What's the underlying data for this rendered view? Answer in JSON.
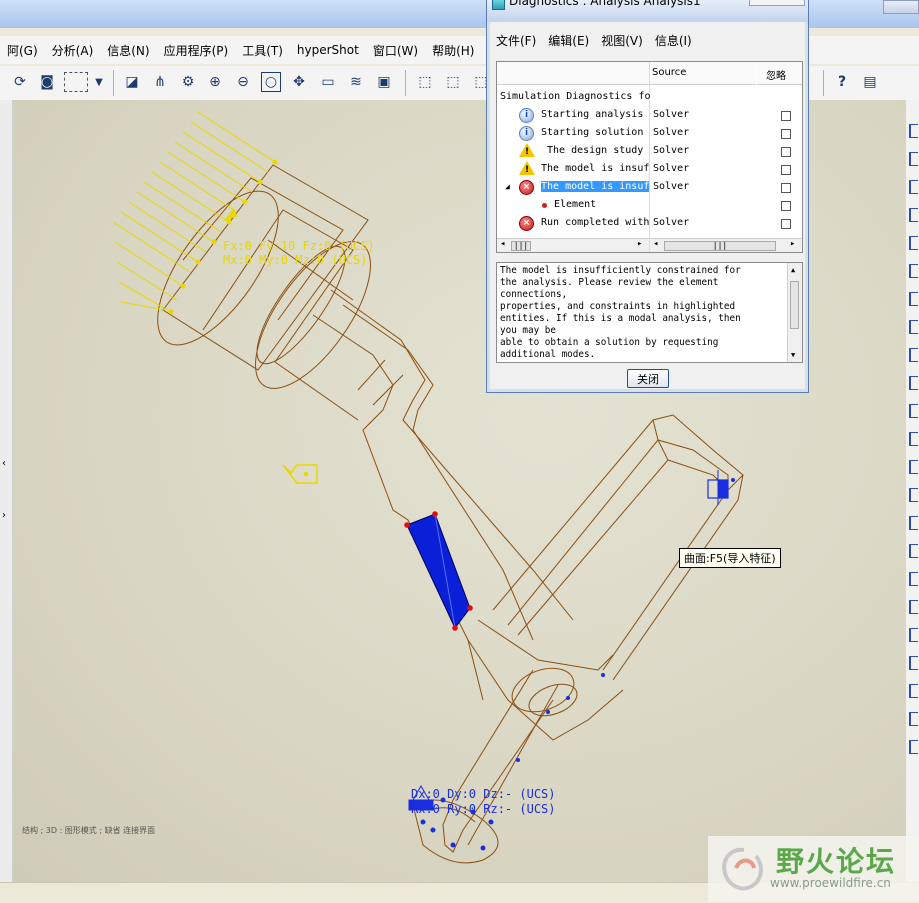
{
  "app": {
    "menus": [
      "阿(G)",
      "分析(A)",
      "信息(N)",
      "应用程序(P)",
      "工具(T)",
      "hyperShot",
      "窗口(W)",
      "帮助(H)"
    ]
  },
  "toolbar": {
    "icons": [
      "repaint-icon",
      "binoculars-icon",
      "select-box-icon",
      "dropdown-icon",
      "sketch-icon",
      "datum-point-icon",
      "orient-icon",
      "zoom-in-icon",
      "zoom-out-icon",
      "zoom-fit-icon",
      "spin-center-icon",
      "annotation-icon",
      "layers-icon",
      "saved-views-icon",
      "shaded-icon",
      "hidden-line-icon",
      "wireframe-icon",
      "whats-this-icon",
      "model-tree-icon"
    ]
  },
  "viewport": {
    "load_label_force": "Fx:0 Fy:10 Fz:0 (UCS)",
    "load_label_moment": "Mx:0 My:0 Mz:0 (UCS)",
    "constraint_label_disp": "Dx:0 Dy:0 Dz:- (UCS)",
    "constraint_label_rot": "Rx:0 Ry:0 Rz:- (UCS)",
    "tooltip": "曲面:F5(导入特征)",
    "status_hint": "结构 ; 3D : 图形模式 ; 缺省 连接界面"
  },
  "dialog": {
    "title": "Diagnostics : Analysis Analysis1",
    "menus": [
      "文件(F)",
      "编辑(E)",
      "视图(V)",
      "信息(I)"
    ],
    "tree": {
      "col_source": "Source",
      "col_ignore": "忽略",
      "root": "Simulation Diagnostics fo",
      "rows": [
        {
          "icon": "info",
          "text": "Starting analysis",
          "source": "Solver"
        },
        {
          "icon": "info",
          "text": "Starting solution",
          "source": "Solver"
        },
        {
          "icon": "warn",
          "text": "The design study",
          "source": "Solver"
        },
        {
          "icon": "warn",
          "text": "The model is insuf",
          "source": "Solver"
        },
        {
          "icon": "err",
          "text": "The model is insuf",
          "source": "Solver",
          "selected": true
        },
        {
          "icon": "dot",
          "text": "Element",
          "source": ""
        },
        {
          "icon": "err",
          "text": "Run completed with",
          "source": "Solver"
        }
      ]
    },
    "message": "The model is insufficiently constrained for\nthe analysis. Please review the element\nconnections,\nproperties, and constraints in highlighted\nentities. If this is a modal analysis, then\nyou may be\nable to obtain a solution by requesting\nadditional modes.",
    "close_label": "关闭"
  },
  "watermark": {
    "text": "野火论坛",
    "url": "www.proewildfire.cn"
  },
  "colors": {
    "wire": "#8a4f12",
    "load": "#e8d800",
    "constraint": "#1a2ee0",
    "highlight": "#0a1fd8",
    "selection": "#3399ff"
  }
}
